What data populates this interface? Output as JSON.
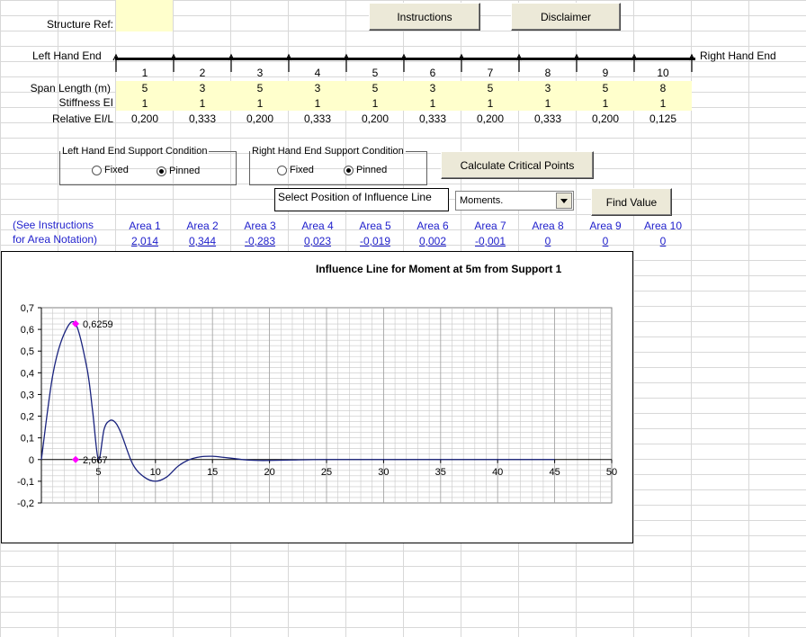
{
  "structure_ref": {
    "label": "Structure Ref:",
    "value": ""
  },
  "buttons": {
    "instructions": "Instructions",
    "disclaimer": "Disclaimer",
    "calculate": "Calculate Critical Points",
    "find_value": "Find Value"
  },
  "beam": {
    "left_end": "Left Hand End",
    "right_end": "Right Hand End"
  },
  "span_table": {
    "row_labels": {
      "span_no": "",
      "span_length": "Span Length (m)",
      "stiffness": "Stiffness EI",
      "relative": "Relative EI/L"
    },
    "spans": [
      {
        "no": "1",
        "length": "5",
        "stiffness": "1",
        "relative": "0,200"
      },
      {
        "no": "2",
        "length": "3",
        "stiffness": "1",
        "relative": "0,333"
      },
      {
        "no": "3",
        "length": "5",
        "stiffness": "1",
        "relative": "0,200"
      },
      {
        "no": "4",
        "length": "3",
        "stiffness": "1",
        "relative": "0,333"
      },
      {
        "no": "5",
        "length": "5",
        "stiffness": "1",
        "relative": "0,200"
      },
      {
        "no": "6",
        "length": "3",
        "stiffness": "1",
        "relative": "0,333"
      },
      {
        "no": "7",
        "length": "5",
        "stiffness": "1",
        "relative": "0,200"
      },
      {
        "no": "8",
        "length": "3",
        "stiffness": "1",
        "relative": "0,333"
      },
      {
        "no": "9",
        "length": "5",
        "stiffness": "1",
        "relative": "0,200"
      },
      {
        "no": "10",
        "length": "8",
        "stiffness": "1",
        "relative": "0,125"
      }
    ]
  },
  "left_support": {
    "title": "Left Hand End Support Condition",
    "fixed": "Fixed",
    "pinned": "Pinned",
    "selected": "pinned"
  },
  "right_support": {
    "title": "Right Hand End Support Condition",
    "fixed": "Fixed",
    "pinned": "Pinned",
    "selected": "pinned"
  },
  "influence_select": {
    "label": "Select Position of Influence Line",
    "value": "Moments."
  },
  "areas": {
    "note_line1": "(See Instructions",
    "note_line2": "for Area Notation)",
    "items": [
      {
        "label": "Area 1",
        "value": "2,014"
      },
      {
        "label": "Area 2",
        "value": "0,344"
      },
      {
        "label": "Area 3",
        "value": "-0,283"
      },
      {
        "label": "Area 4",
        "value": "0,023"
      },
      {
        "label": "Area 5",
        "value": "-0,019"
      },
      {
        "label": "Area 6",
        "value": "0,002"
      },
      {
        "label": "Area 7",
        "value": "-0,001"
      },
      {
        "label": "Area 8",
        "value": "0"
      },
      {
        "label": "Area 9",
        "value": "0"
      },
      {
        "label": "Area 10",
        "value": "0"
      }
    ]
  },
  "chart_data": {
    "type": "line",
    "title": "Influence Line for Moment at 5m from Support 1",
    "xlabel": "",
    "ylabel": "",
    "xlim": [
      0,
      50
    ],
    "ylim": [
      -0.2,
      0.7
    ],
    "x_ticks": [
      "5",
      "10",
      "15",
      "20",
      "25",
      "30",
      "35",
      "40",
      "45",
      "50"
    ],
    "y_ticks": [
      "0,7",
      "0,6",
      "0,5",
      "0,4",
      "0,3",
      "0,2",
      "0,1",
      "0",
      "-0,1",
      "-0,2"
    ],
    "grid": true,
    "line_color": "#1a237e",
    "marker_color": "#ff00ff",
    "series": [
      {
        "x": [
          0,
          1,
          2,
          3,
          4,
          4.5,
          5,
          5.5,
          6,
          6.5,
          7,
          8,
          9,
          10,
          11,
          12,
          13,
          14,
          15,
          16,
          17,
          18,
          19,
          20,
          22,
          25,
          30,
          35,
          40,
          45
        ],
        "y": [
          0,
          0.39,
          0.58,
          0.626,
          0.42,
          0.22,
          0,
          0.14,
          0.18,
          0.17,
          0.12,
          -0.02,
          -0.08,
          -0.1,
          -0.08,
          -0.03,
          0.0,
          0.013,
          0.015,
          0.01,
          0.004,
          -0.002,
          -0.004,
          -0.004,
          -0.002,
          0,
          0,
          0,
          0,
          0
        ]
      }
    ],
    "annotations": [
      {
        "x": 3,
        "y": 0.6259,
        "label": "0,6259"
      },
      {
        "x": 3,
        "y": 0,
        "label": "2,667"
      }
    ]
  }
}
